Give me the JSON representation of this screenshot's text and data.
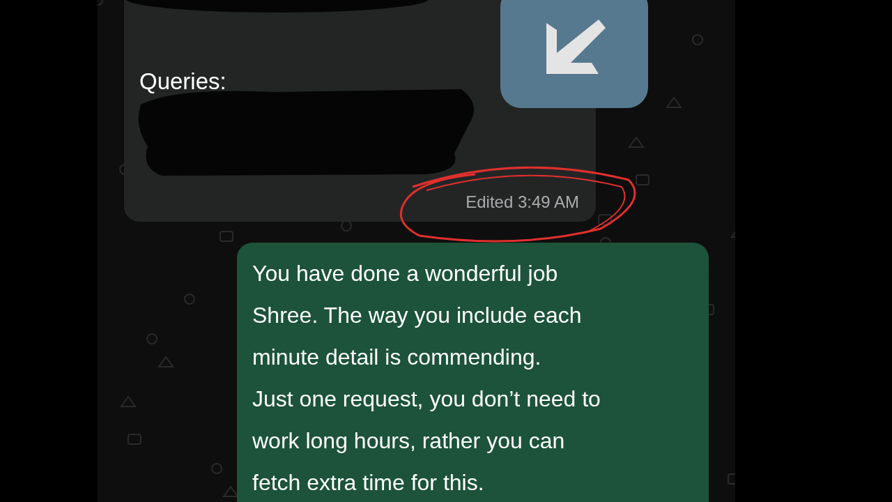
{
  "messages": [
    {
      "kind": "incoming",
      "heading": "Queries:",
      "meta": "Edited 3:49 AM",
      "highlighted": true
    },
    {
      "kind": "outgoing",
      "text": "You have done a wonderful job\nShree. The way you include each\nminute detail is commending.\nJust one request, you don’t need to\nwork long hours, rather you can\nfetch extra time for this."
    }
  ]
}
